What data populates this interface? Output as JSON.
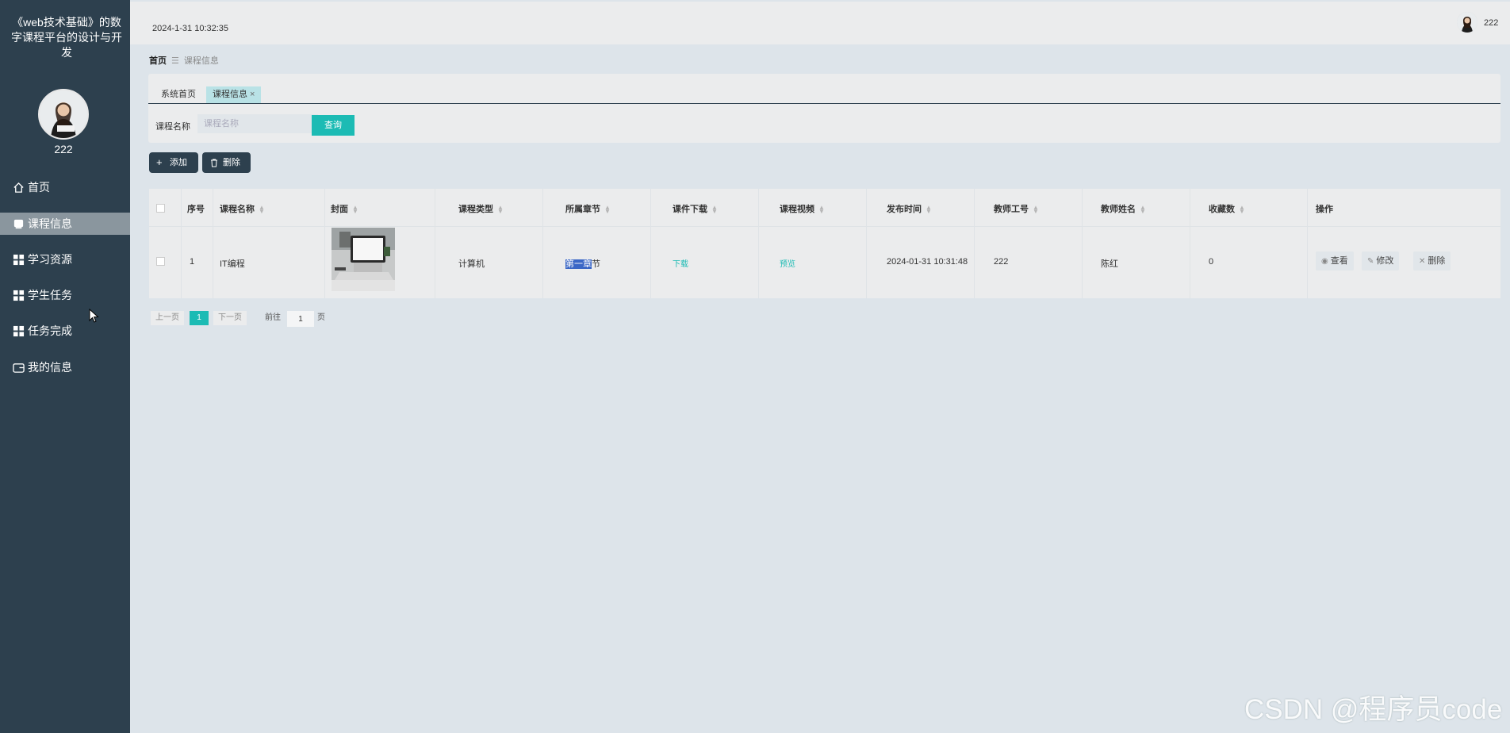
{
  "app": {
    "title": "《web技术基础》的数字课程平台的设计与开发"
  },
  "sidebar": {
    "username": "222",
    "items": [
      {
        "label": "首页",
        "icon": "home-icon"
      },
      {
        "label": "课程信息",
        "icon": "course-icon",
        "active": true
      },
      {
        "label": "学习资源",
        "icon": "grid-icon"
      },
      {
        "label": "学生任务",
        "icon": "grid-icon"
      },
      {
        "label": "任务完成",
        "icon": "grid-icon"
      },
      {
        "label": "我的信息",
        "icon": "wallet-icon"
      }
    ]
  },
  "header": {
    "datetime": "2024-1-31 10:32:35",
    "username": "222"
  },
  "breadcrumb": {
    "home": "首页",
    "current": "课程信息"
  },
  "tabs": {
    "home": "系统首页",
    "course": "课程信息",
    "close": "×"
  },
  "search": {
    "label": "课程名称",
    "placeholder": "课程名称",
    "button": "查询"
  },
  "actions": {
    "add": "添加",
    "delete": "删除"
  },
  "table": {
    "headers": [
      "序号",
      "课程名称",
      "封面",
      "课程类型",
      "所属章节",
      "课件下载",
      "课程视频",
      "发布时间",
      "教师工号",
      "教师姓名",
      "收藏数",
      "操作"
    ],
    "rows": [
      {
        "index": "1",
        "course_name": "IT编程",
        "course_type": "计算机",
        "chapter_selected": "第一章",
        "chapter_rest": "节",
        "download": "下载",
        "video": "预览",
        "publish_time": "2024-01-31 10:31:48",
        "teacher_id": "222",
        "teacher_name": "陈红",
        "favorites": "0",
        "ops": {
          "view": "查看",
          "edit": "修改",
          "delete": "删除"
        }
      }
    ]
  },
  "pagination": {
    "prev": "上一页",
    "current": "1",
    "next": "下一页",
    "goto": "前往",
    "page_input": "1",
    "page_unit": "页"
  },
  "watermark": "CSDN @程序员code",
  "colors": {
    "sidebar": "#2d404e",
    "accent": "#1cbbb4",
    "background": "#dde4ea"
  }
}
